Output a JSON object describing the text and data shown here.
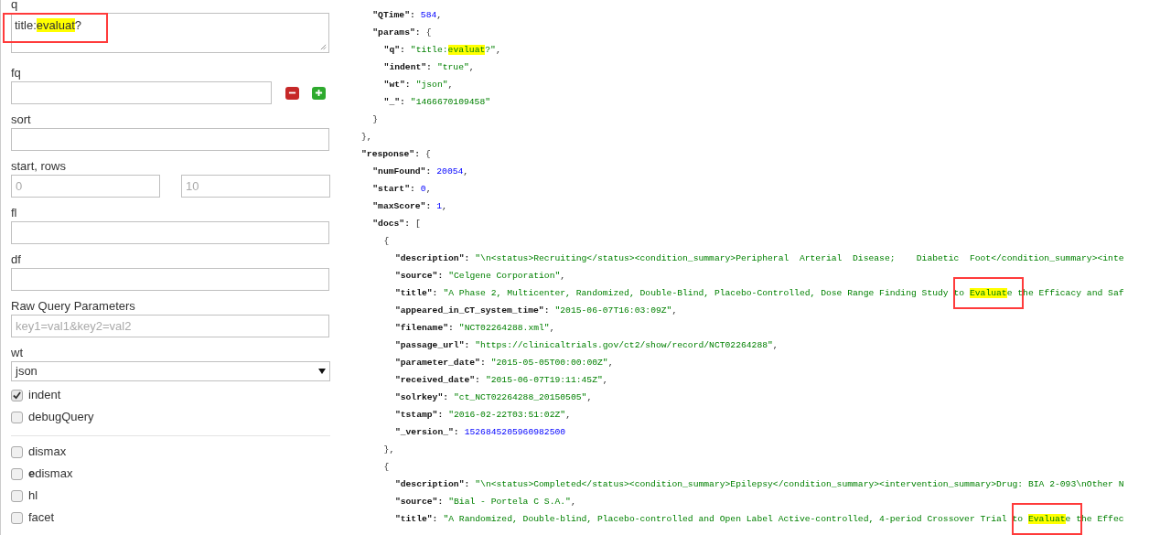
{
  "query_form": {
    "q": {
      "label": "q",
      "annotated": true,
      "value": [
        {
          "text": "title:",
          "highlighted": false
        },
        {
          "text": "evaluat",
          "highlighted": true
        },
        {
          "text": "?",
          "highlighted": false
        }
      ]
    },
    "fq": {
      "label": "fq"
    },
    "sort": {
      "label": "sort"
    },
    "start_rows": {
      "label": "start, rows",
      "start_placeholder": "0",
      "rows_placeholder": "10"
    },
    "fl": {
      "label": "fl"
    },
    "df": {
      "label": "df"
    },
    "raw": {
      "label": "Raw Query Parameters",
      "placeholder": "key1=val1&key2=val2"
    },
    "wt": {
      "label": "wt",
      "value": "json"
    },
    "options": [
      {
        "label": "indent",
        "checked": true
      },
      {
        "label": "debugQuery",
        "checked": false
      }
    ],
    "parsers": [
      {
        "label": "dismax",
        "checked": false
      },
      {
        "label": "**e**dismax",
        "checked": false
      },
      {
        "label": "hl",
        "checked": false
      },
      {
        "label": "facet",
        "checked": false
      }
    ]
  },
  "response_lines": [
    {
      "kind": "object",
      "close": "},",
      "children": [
        {
          "kind": "number",
          "key": "\"QTime\":",
          "value": "584",
          "after": ","
        },
        {
          "kind": "object",
          "key": "\"params\":",
          "open": "{",
          "close": "}",
          "children": [
            {
              "kind": "string",
              "key": "\"q\":",
              "value": [
                {
                  "text": "\"title:",
                  "highlighted": false
                },
                {
                  "text": "evaluat",
                  "highlighted": true,
                  "annotated": false
                },
                {
                  "text": "?\"",
                  "highlighted": false
                }
              ],
              "after": ","
            },
            {
              "kind": "string",
              "key": "\"indent\":",
              "value": "\"true\"",
              "after": ","
            },
            {
              "kind": "string",
              "key": "\"wt\":",
              "value": "\"json\"",
              "after": ","
            },
            {
              "kind": "string",
              "key": "\"_\":",
              "value": "\"1466670109458\""
            }
          ]
        }
      ]
    },
    {
      "kind": "object",
      "key": "\"response\":",
      "open": "{",
      "children": [
        {
          "kind": "number",
          "key": "\"numFound\":",
          "value": "20054",
          "after": ","
        },
        {
          "kind": "number",
          "key": "\"start\":",
          "value": "0",
          "after": ","
        },
        {
          "kind": "number",
          "key": "\"maxScore\":",
          "value": "1",
          "after": ","
        },
        {
          "kind": "object",
          "key": "\"docs\":",
          "open": "[",
          "children": [
            {
              "kind": "object",
              "open": "{",
              "close": "},",
              "children": [
                {
                  "kind": "string",
                  "key": "\"description\":",
                  "value": "\"\\n<status>Recruiting</status><condition_summary>Peripheral  Arterial  Disease;    Diabetic  Foot</condition_summary><inte"
                },
                {
                  "kind": "string",
                  "key": "\"source\":",
                  "value": "\"Celgene Corporation\"",
                  "after": ","
                },
                {
                  "kind": "string",
                  "key": "\"title\":",
                  "value": [
                    {
                      "text": "\"A Phase 2, Multicenter, Randomized, Double-Blind, Placebo-Controlled, Dose Range Finding Study to ",
                      "highlighted": false
                    },
                    {
                      "text": "Evaluat",
                      "highlighted": true,
                      "annotated": true
                    },
                    {
                      "text": "e the Efficacy and Saf",
                      "highlighted": false
                    }
                  ]
                },
                {
                  "kind": "string",
                  "key": "\"appeared_in_CT_system_time\":",
                  "value": "\"2015-06-07T16:03:09Z\"",
                  "after": ","
                },
                {
                  "kind": "string",
                  "key": "\"filename\":",
                  "value": "\"NCT02264288.xml\"",
                  "after": ","
                },
                {
                  "kind": "string",
                  "key": "\"passage_url\":",
                  "value": "\"https://clinicaltrials.gov/ct2/show/record/NCT02264288\"",
                  "after": ","
                },
                {
                  "kind": "string",
                  "key": "\"parameter_date\":",
                  "value": "\"2015-05-05T00:00:00Z\"",
                  "after": ","
                },
                {
                  "kind": "string",
                  "key": "\"received_date\":",
                  "value": "\"2015-06-07T19:11:45Z\"",
                  "after": ","
                },
                {
                  "kind": "string",
                  "key": "\"solrkey\":",
                  "value": "\"ct_NCT02264288_20150505\"",
                  "after": ","
                },
                {
                  "kind": "string",
                  "key": "\"tstamp\":",
                  "value": "\"2016-02-22T03:51:02Z\"",
                  "after": ","
                },
                {
                  "kind": "number",
                  "key": "\"_version_\":",
                  "value": "1526845205960982500"
                }
              ]
            },
            {
              "kind": "object",
              "open": "{",
              "children": [
                {
                  "kind": "string",
                  "key": "\"description\":",
                  "value": "\"\\n<status>Completed</status><condition_summary>Epilepsy</condition_summary><intervention_summary>Drug: BIA 2-093\\nOther N"
                },
                {
                  "kind": "string",
                  "key": "\"source\":",
                  "value": "\"Bial - Portela C S.A.\"",
                  "after": ","
                },
                {
                  "kind": "string",
                  "key": "\"title\":",
                  "value": [
                    {
                      "text": "\"A Randomized, Double-blind, Placebo-controlled and Open Label Active-controlled, 4-period Crossover Trial to ",
                      "highlighted": false
                    },
                    {
                      "text": "Evaluat",
                      "highlighted": true,
                      "annotated": true
                    },
                    {
                      "text": "e the Effec",
                      "highlighted": false
                    }
                  ]
                }
              ]
            }
          ]
        }
      ]
    }
  ]
}
